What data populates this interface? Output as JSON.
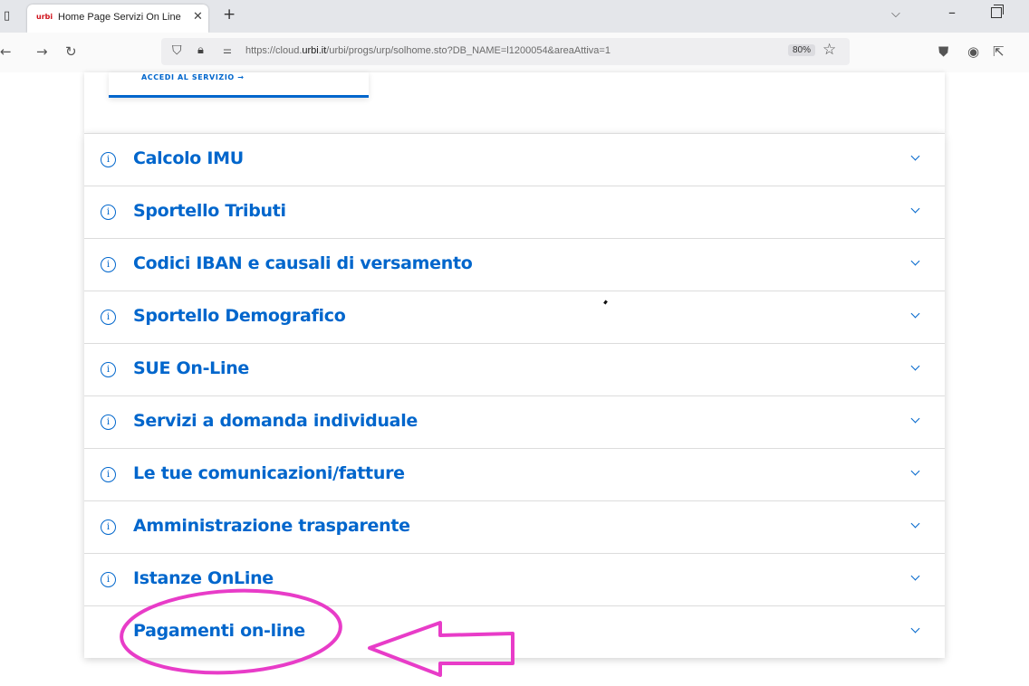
{
  "browser": {
    "tab_title": "Home Page Servizi On Line",
    "tab_favicon_text": "urbi",
    "url_host_prefix": "https://cloud.",
    "url_host_bold": "urbi.it",
    "url_path": "/urbi/progs/urp/solhome.sto?DB_NAME=l1200054&areaAttiva=1",
    "zoom": "80%",
    "icons": [
      "sidebar-icon",
      "close-icon",
      "plus-icon",
      "chevron-down-icon",
      "minimize-icon",
      "restore-icon",
      "back-icon",
      "forward-icon",
      "reload-icon",
      "shield-icon",
      "lock-icon",
      "permissions-icon",
      "star-icon",
      "pocket-icon",
      "account-icon",
      "extensions-icon"
    ]
  },
  "page": {
    "service_link": "ACCEDI AL SERVIZIO →",
    "accordion": [
      {
        "label": "Calcolo IMU",
        "has_info": true
      },
      {
        "label": "Sportello Tributi",
        "has_info": true
      },
      {
        "label": "Codici IBAN e causali di versamento",
        "has_info": true
      },
      {
        "label": "Sportello Demografico",
        "has_info": true
      },
      {
        "label": "SUE On-Line",
        "has_info": true
      },
      {
        "label": "Servizi a domanda individuale",
        "has_info": true
      },
      {
        "label": "Le tue comunicazioni/fatture",
        "has_info": true
      },
      {
        "label": "Amministrazione trasparente",
        "has_info": true
      },
      {
        "label": "Istanze OnLine",
        "has_info": true
      },
      {
        "label": "Pagamenti on-line",
        "has_info": false
      }
    ],
    "info_glyph": "i"
  },
  "colors": {
    "accent": "#0066cc",
    "annotation": "#e83cc8"
  }
}
